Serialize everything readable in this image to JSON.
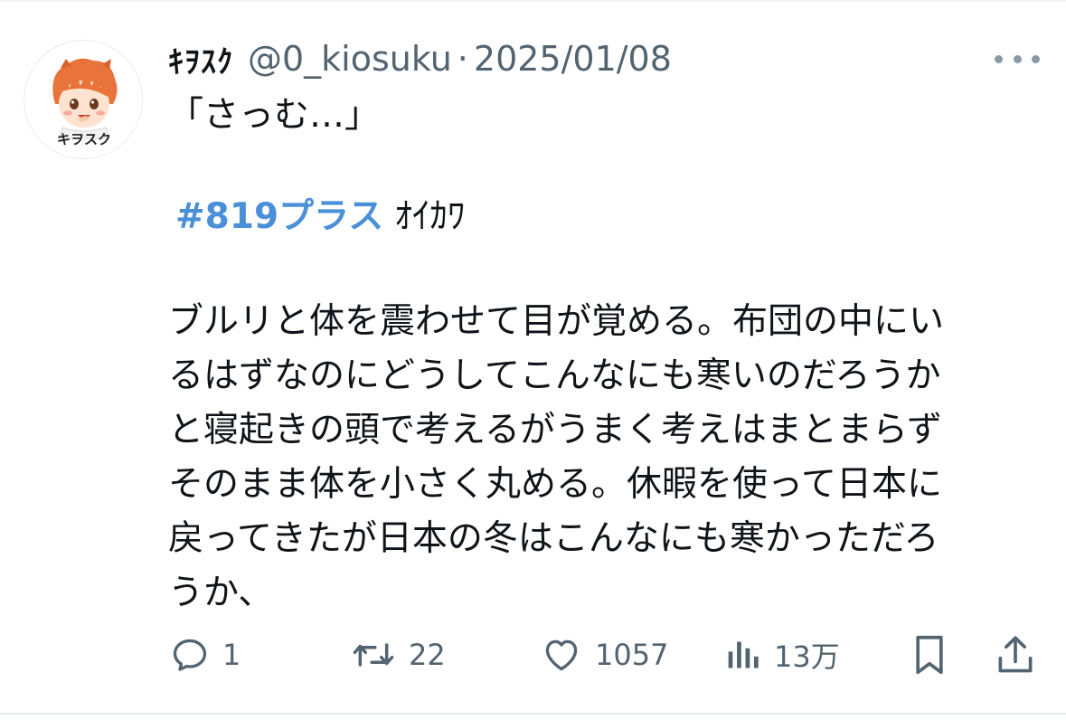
{
  "tweet": {
    "author": {
      "display_name": "ｷｦｽｸ",
      "handle": "@0_kiosuku",
      "avatar_label": "キヲスク"
    },
    "separator": "·",
    "date": "2025/01/08",
    "text": {
      "line_1": "「さっむ…」",
      "hashtag": "#819プラス",
      "hashtag_suffix": "ｵｲｶﾜ",
      "body_lines": [
        "ブルリと体を震わせて目が覚める。布団の中にい",
        "るはずなのにどうしてこんなにも寒いのだろうか",
        "と寝起きの頭で考えるがうまく考えはまとまらず",
        "そのまま体を小さく丸める。休暇を使って日本に",
        "戻ってきたが日本の冬はこんなにも寒かっただろ",
        "うか、"
      ]
    },
    "actions": {
      "reply_count": "1",
      "retweet_count": "22",
      "like_count": "1057",
      "views_count": "13万"
    }
  },
  "icons": {
    "more": "more-dots-icon",
    "reply": "reply-bubble-icon",
    "retweet": "retweet-arrows-icon",
    "like": "heart-icon",
    "views": "views-bars-icon",
    "bookmark": "bookmark-icon",
    "share": "share-upload-icon"
  },
  "colors": {
    "text": "#0f1419",
    "secondary": "#536471",
    "hashtag": "#4a90d9",
    "avatar_hair": "#e8743b",
    "divider": "#eff3f4"
  }
}
